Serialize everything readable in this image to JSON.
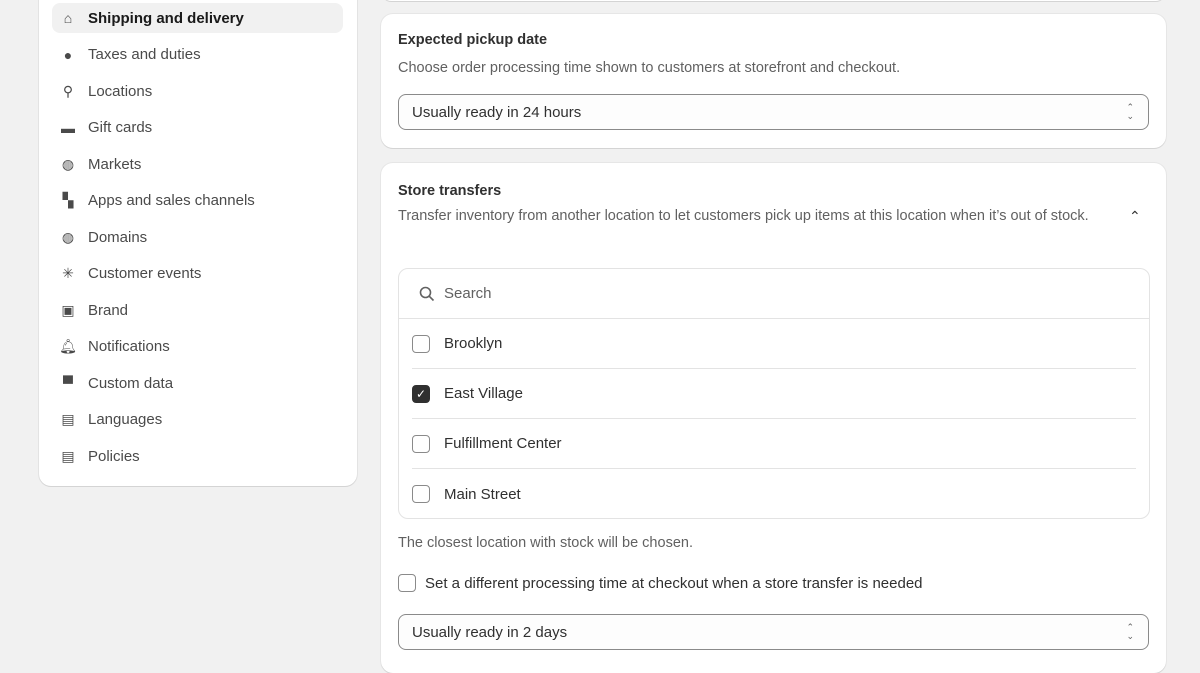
{
  "sidebar": {
    "items": [
      {
        "label": "Shipping and delivery",
        "icon": "store-icon",
        "active": true
      },
      {
        "label": "Taxes and duties",
        "icon": "tax-bag-icon"
      },
      {
        "label": "Locations",
        "icon": "location-pin-icon"
      },
      {
        "label": "Gift cards",
        "icon": "gift-card-icon"
      },
      {
        "label": "Markets",
        "icon": "globe-dollar-icon"
      },
      {
        "label": "Apps and sales channels",
        "icon": "apps-icon"
      },
      {
        "label": "Domains",
        "icon": "globe-cursor-icon"
      },
      {
        "label": "Customer events",
        "icon": "cursor-click-icon"
      },
      {
        "label": "Brand",
        "icon": "image-icon"
      },
      {
        "label": "Notifications",
        "icon": "bell-icon"
      },
      {
        "label": "Custom data",
        "icon": "blocks-icon"
      },
      {
        "label": "Languages",
        "icon": "translate-icon"
      },
      {
        "label": "Policies",
        "icon": "document-icon"
      }
    ]
  },
  "pickup": {
    "title": "Expected pickup date",
    "description": "Choose order processing time shown to customers at storefront and checkout.",
    "select_value": "Usually ready in 24 hours"
  },
  "transfers": {
    "title": "Store transfers",
    "description": "Transfer inventory from another location to let customers pick up items at this location when it’s out of stock.",
    "search_placeholder": "Search",
    "locations": [
      {
        "label": "Brooklyn",
        "checked": false
      },
      {
        "label": "East Village",
        "checked": true
      },
      {
        "label": "Fulfillment Center",
        "checked": false
      },
      {
        "label": "Main Street",
        "checked": false
      }
    ],
    "note": "The closest location with stock will be chosen.",
    "different_time_label": "Set a different processing time at checkout when a store transfer is needed",
    "different_time_checked": false,
    "select_value": "Usually ready in 2 days"
  }
}
